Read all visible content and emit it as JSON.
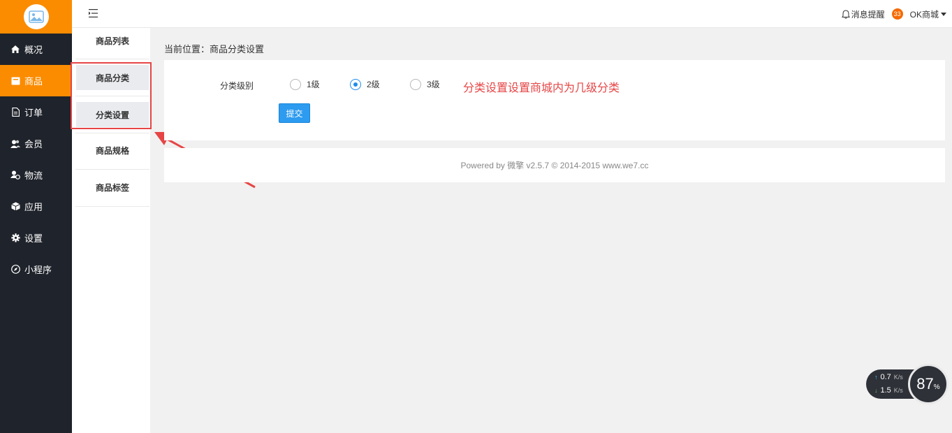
{
  "sidebar": {
    "logo_icon": "image-icon",
    "accent": "#fb8c00",
    "items": [
      {
        "label": "概况",
        "icon": "home-icon"
      },
      {
        "label": "商品",
        "icon": "box-icon"
      },
      {
        "label": "订单",
        "icon": "document-icon"
      },
      {
        "label": "会员",
        "icon": "users-icon"
      },
      {
        "label": "物流",
        "icon": "truck-icon"
      },
      {
        "label": "应用",
        "icon": "cube-icon"
      },
      {
        "label": "设置",
        "icon": "gear-icon"
      },
      {
        "label": "小程序",
        "icon": "compass-icon"
      }
    ]
  },
  "topbar": {
    "notify_label": "消息提醒",
    "badge_count": "33",
    "shop_name": "OK商城"
  },
  "subnav": {
    "items": [
      {
        "label": "商品列表"
      },
      {
        "label": "商品分类"
      },
      {
        "label": "分类设置"
      },
      {
        "label": "商品规格"
      },
      {
        "label": "商品标签"
      }
    ]
  },
  "main": {
    "breadcrumb": "当前位置：商品分类设置",
    "form_label": "分类级别",
    "options": [
      {
        "label": "1级",
        "checked": false
      },
      {
        "label": "2级",
        "checked": true
      },
      {
        "label": "3级",
        "checked": false
      }
    ],
    "note": "分类设置设置商城内为几级分类",
    "submit_label": "提交"
  },
  "footer": {
    "text": "Powered by 微擎 v2.5.7 © 2014-2015 www.we7.cc"
  },
  "speed_widget": {
    "up": "0.7",
    "down": "1.5",
    "unit": "K/s",
    "percent": "87",
    "percent_sign": "%"
  }
}
